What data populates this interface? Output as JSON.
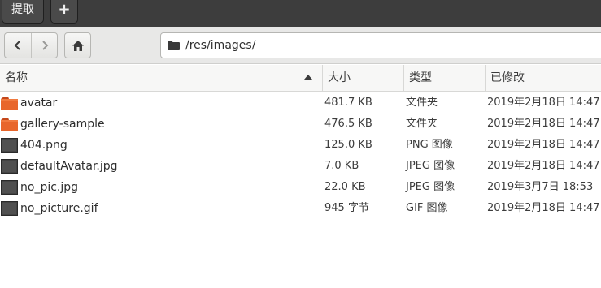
{
  "header": {
    "extract_label": "提取",
    "add_label": "+"
  },
  "toolbar": {
    "back_icon": "chevron-left-icon",
    "forward_icon": "chevron-right-icon",
    "home_icon": "home-icon",
    "path_icon": "folder-icon",
    "path": "/res/images/"
  },
  "columns": {
    "name": "名称",
    "size": "大小",
    "type": "类型",
    "modified": "已修改"
  },
  "files": [
    {
      "name": "avatar",
      "size": "481.7 KB",
      "type": "文件夹",
      "modified": "2019年2月18日 14:47",
      "icon": "folder-icon"
    },
    {
      "name": "gallery-sample",
      "size": "476.5 KB",
      "type": "文件夹",
      "modified": "2019年2月18日 14:47",
      "icon": "folder-icon"
    },
    {
      "name": "404.png",
      "size": "125.0 KB",
      "type": "PNG 图像",
      "modified": "2019年2月18日 14:47",
      "icon": "image-file-icon"
    },
    {
      "name": "defaultAvatar.jpg",
      "size": "7.0 KB",
      "type": "JPEG 图像",
      "modified": "2019年2月18日 14:47",
      "icon": "image-file-icon"
    },
    {
      "name": "no_pic.jpg",
      "size": "22.0 KB",
      "type": "JPEG 图像",
      "modified": "2019年3月7日 18:53",
      "icon": "image-file-icon"
    },
    {
      "name": "no_picture.gif",
      "size": "945 字节",
      "type": "GIF 图像",
      "modified": "2019年2月18日 14:47",
      "icon": "image-file-icon"
    }
  ],
  "colors": {
    "folder": "#e8662b",
    "folder_dark": "#c4471a",
    "image_thumb": "#444444",
    "topbar": "#3d3d3d"
  }
}
